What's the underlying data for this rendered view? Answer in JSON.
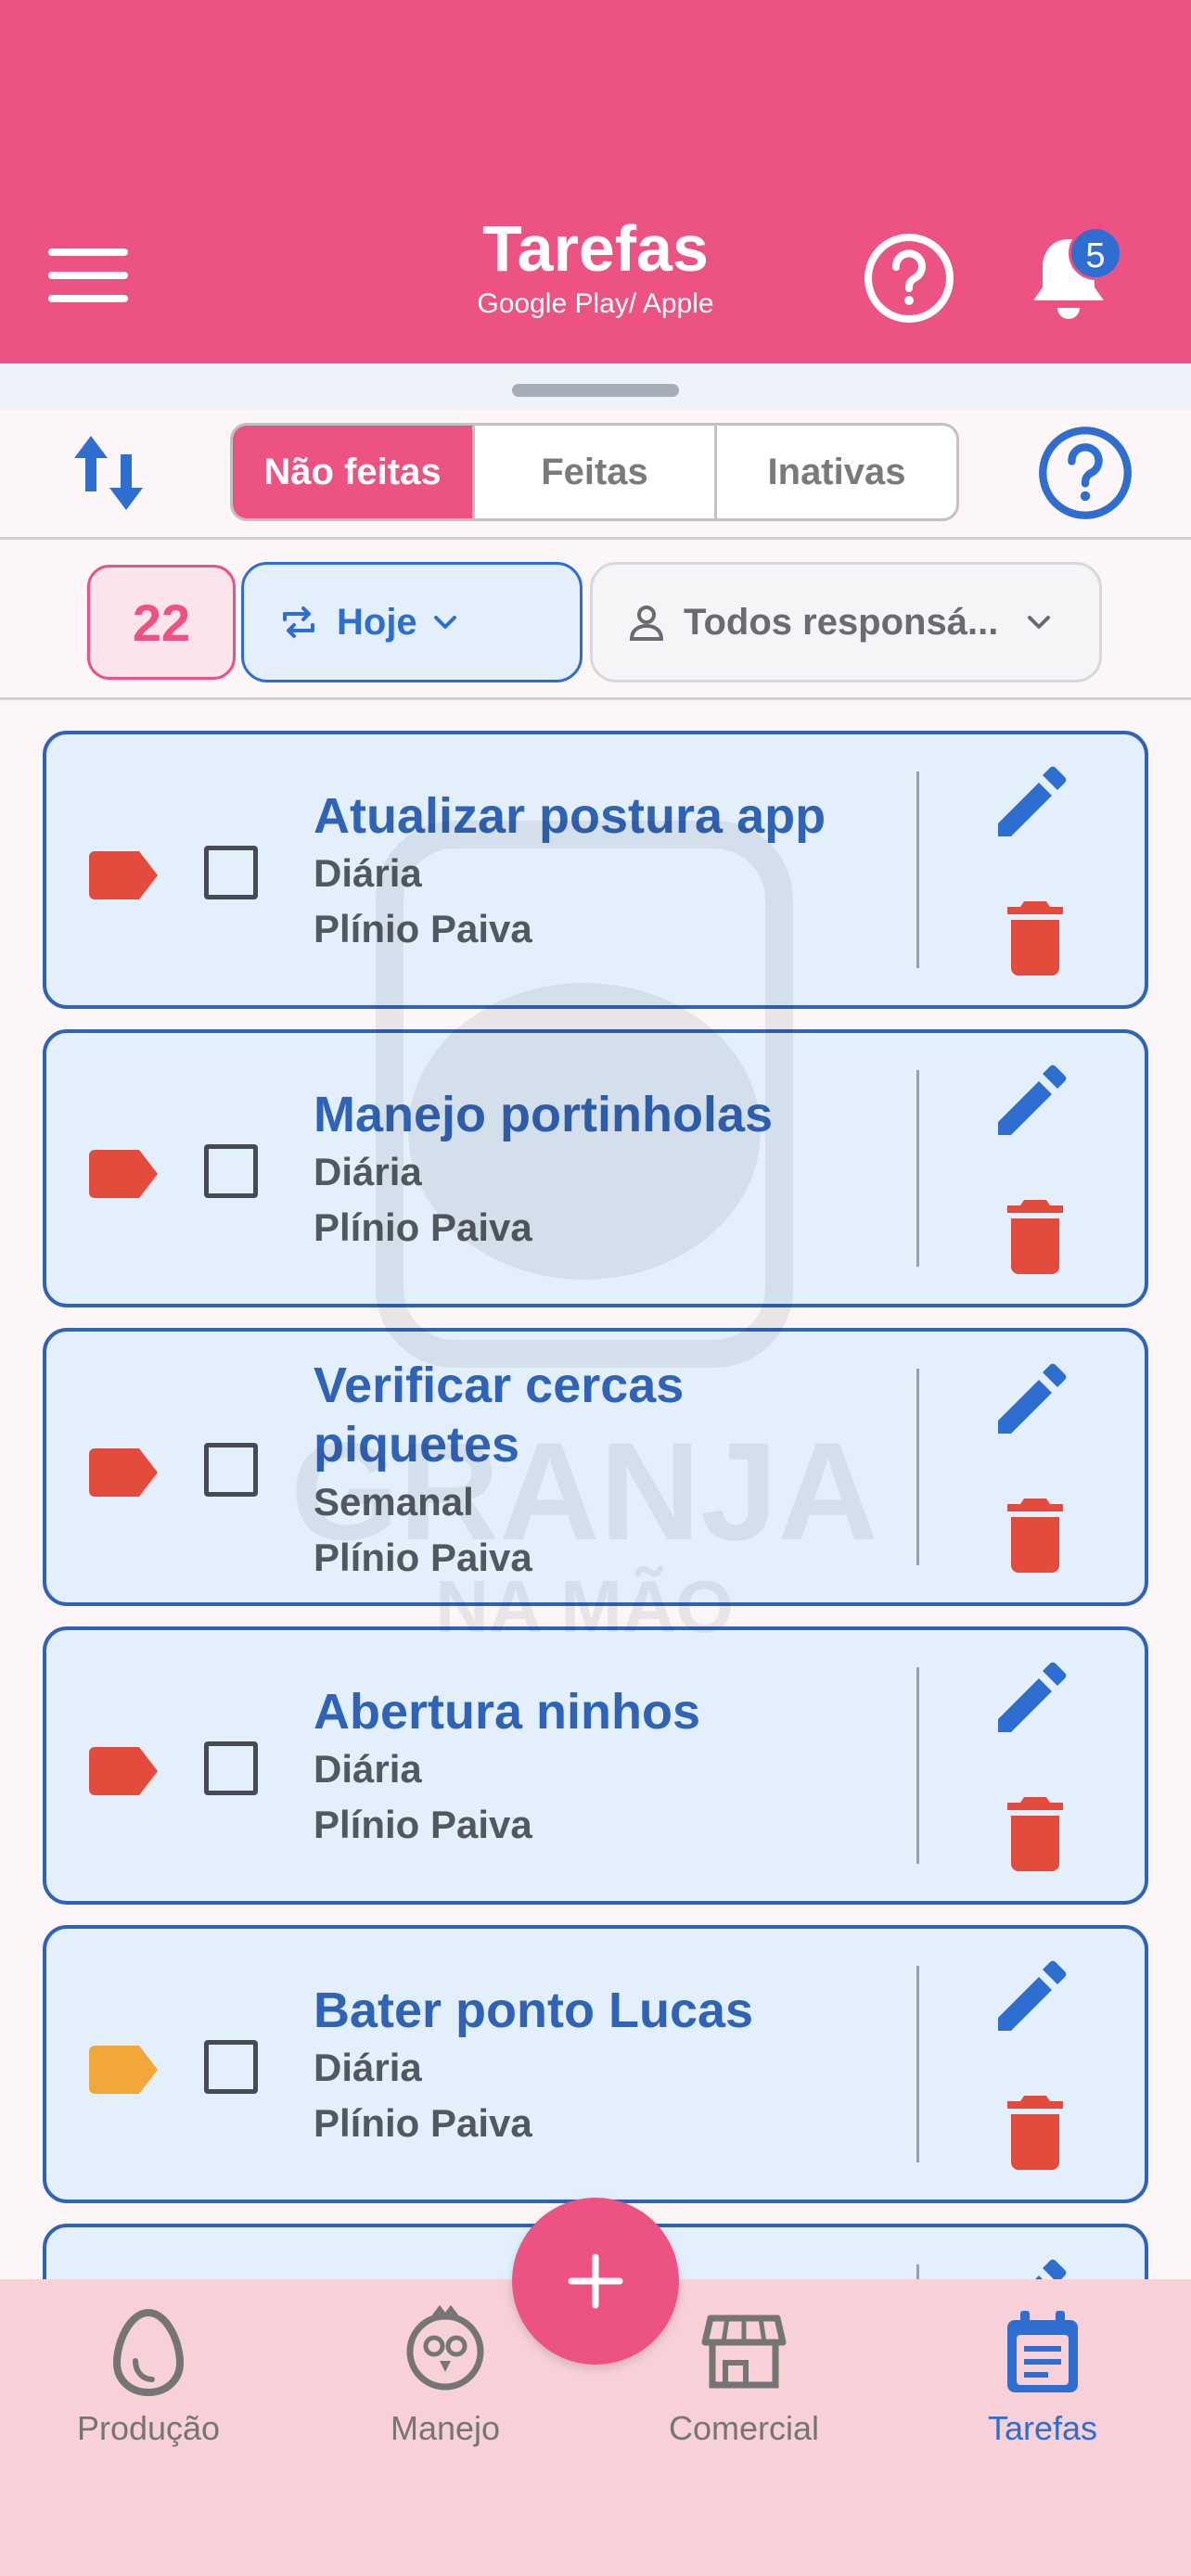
{
  "header": {
    "title": "Tarefas",
    "subtitle": "Google Play/ Apple",
    "notification_count": "5",
    "brand_color": "#ec5282"
  },
  "tabs": [
    {
      "label": "Não feitas",
      "active": true
    },
    {
      "label": "Feitas",
      "active": false
    },
    {
      "label": "Inativas",
      "active": false
    }
  ],
  "filters": {
    "count": "22",
    "period": "Hoje",
    "responsible": "Todos responsá..."
  },
  "watermark": {
    "line1": "GRANJA",
    "line2": "NA MÃO"
  },
  "tasks": [
    {
      "title": "Atualizar postura app",
      "frequency": "Diária",
      "responsible": "Plínio Paiva",
      "tag_color": "#e34c3c",
      "done": false
    },
    {
      "title": "Manejo portinholas",
      "frequency": "Diária",
      "responsible": "Plínio Paiva",
      "tag_color": "#e34c3c",
      "done": false
    },
    {
      "title": "Verificar cercas piquetes",
      "frequency": "Semanal",
      "responsible": "Plínio Paiva",
      "tag_color": "#e34c3c",
      "done": false
    },
    {
      "title": "Abertura ninhos",
      "frequency": "Diária",
      "responsible": "Plínio Paiva",
      "tag_color": "#e34c3c",
      "done": false
    },
    {
      "title": "Bater ponto Lucas",
      "frequency": "Diária",
      "responsible": "Plínio Paiva",
      "tag_color": "#f2a73b",
      "done": false
    }
  ],
  "nav": [
    {
      "label": "Produção",
      "icon": "egg-icon",
      "active": false
    },
    {
      "label": "Manejo",
      "icon": "chicken-icon",
      "active": false
    },
    {
      "label": "Comercial",
      "icon": "store-icon",
      "active": false
    },
    {
      "label": "Tarefas",
      "icon": "task-list-icon",
      "active": true
    }
  ],
  "colors": {
    "accent_blue": "#2e6ed1",
    "card_border": "#2f63b7",
    "card_bg": "#e3f0fc",
    "delete_red": "#e34c3c"
  }
}
